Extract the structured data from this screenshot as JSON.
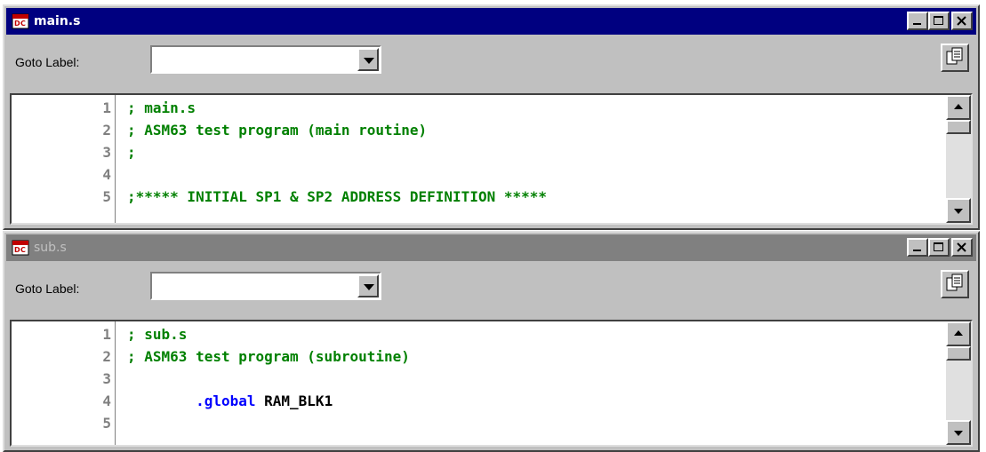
{
  "windows": [
    {
      "title": "main.s",
      "active": true,
      "goto_label": "Goto Label:",
      "goto_value": "",
      "lines": [
        {
          "num": "1",
          "segments": [
            {
              "text": "; main.s",
              "color": "green"
            }
          ]
        },
        {
          "num": "2",
          "segments": [
            {
              "text": "; ASM63 test program (main routine)",
              "color": "green"
            }
          ]
        },
        {
          "num": "3",
          "segments": [
            {
              "text": ";",
              "color": "green"
            }
          ]
        },
        {
          "num": "4",
          "segments": []
        },
        {
          "num": "5",
          "segments": [
            {
              "text": ";***** INITIAL SP1 & SP2 ADDRESS DEFINITION *****",
              "color": "green"
            }
          ]
        }
      ]
    },
    {
      "title": "sub.s",
      "active": false,
      "goto_label": "Goto Label:",
      "goto_value": "",
      "lines": [
        {
          "num": "1",
          "segments": [
            {
              "text": "; sub.s",
              "color": "green"
            }
          ]
        },
        {
          "num": "2",
          "segments": [
            {
              "text": "; ASM63 test program (subroutine)",
              "color": "green"
            }
          ]
        },
        {
          "num": "3",
          "segments": []
        },
        {
          "num": "4",
          "segments": [
            {
              "text": "        .global",
              "color": "blue"
            },
            {
              "text": " RAM_BLK1",
              "color": "black"
            }
          ]
        },
        {
          "num": "5",
          "segments": []
        }
      ]
    }
  ],
  "colors": {
    "active_title": "#000080",
    "inactive_title": "#808080",
    "comment": "#008000",
    "directive": "#0000ff"
  },
  "icons": [
    "doc-icon",
    "minimize-icon",
    "maximize-icon",
    "close-icon",
    "copy-icon",
    "dropdown-arrow-icon",
    "scroll-up-icon",
    "scroll-down-icon"
  ]
}
